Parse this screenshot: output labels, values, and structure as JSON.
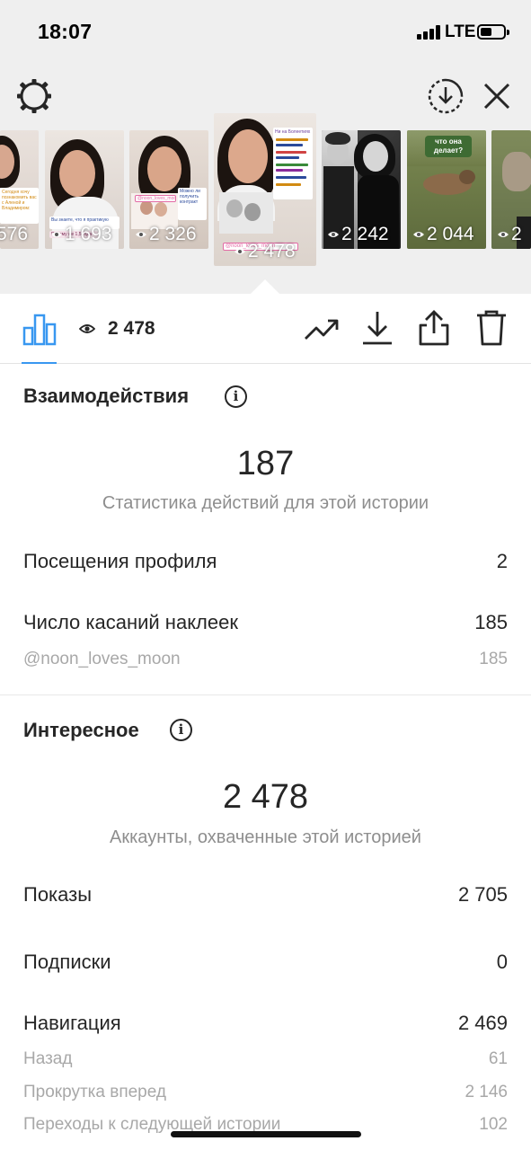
{
  "status_bar": {
    "time": "18:07",
    "network": "LTE"
  },
  "stories": [
    {
      "views": "576"
    },
    {
      "views": "1 693"
    },
    {
      "views": "2 326"
    },
    {
      "views": "2 478",
      "selected": true
    },
    {
      "views": "2 242"
    },
    {
      "views": "2 044"
    },
    {
      "views": "2"
    }
  ],
  "story_text": {
    "s1_card": "Сегодня хочу познакомить вас с Аленой и Владимиром: ",
    "s1_card2": "Вы знаете, что я практикую",
    "s2_card": "Вы знаете, что я практикую",
    "s2_card2": "Почему же 1,5 года",
    "s3_card": "Можно ли получить контракт",
    "s3_sticker": "@noon_loves_moon",
    "s4_card": "Ни на Болеетиях",
    "s4_sticker": "@noon_loves_moon",
    "s6_label": "что она делает?"
  },
  "toolbar": {
    "views": "2 478"
  },
  "interactions": {
    "title": "Взаимодействия",
    "total": "187",
    "caption": "Статистика действий для этой истории",
    "rows": [
      {
        "label": "Посещения профиля",
        "value": "2"
      },
      {
        "label": "Число касаний наклеек",
        "value": "185"
      }
    ],
    "sub_rows": [
      {
        "label": "@noon_loves_moon",
        "value": "185"
      }
    ]
  },
  "discovery": {
    "title": "Интересное",
    "total": "2 478",
    "caption": "Аккаунты, охваченные этой историей",
    "rows": [
      {
        "label": "Показы",
        "value": "2 705"
      },
      {
        "label": "Подписки",
        "value": "0"
      },
      {
        "label": "Навигация",
        "value": "2 469"
      }
    ],
    "sub_rows": [
      {
        "label": "Назад",
        "value": "61"
      },
      {
        "label": "Прокрутка вперед",
        "value": "2 146"
      },
      {
        "label": "Переходы к следующей истории",
        "value": "102"
      }
    ]
  },
  "colors": {
    "accent": "#3897f0",
    "background_top": "#efefef",
    "text": "#262626",
    "muted": "#8e8e8e"
  },
  "icons": [
    "settings-gear-icon",
    "download-circle-icon",
    "close-icon",
    "bar-chart-icon",
    "eye-icon",
    "trending-up-icon",
    "download-icon",
    "share-icon",
    "trash-icon",
    "info-icon"
  ]
}
